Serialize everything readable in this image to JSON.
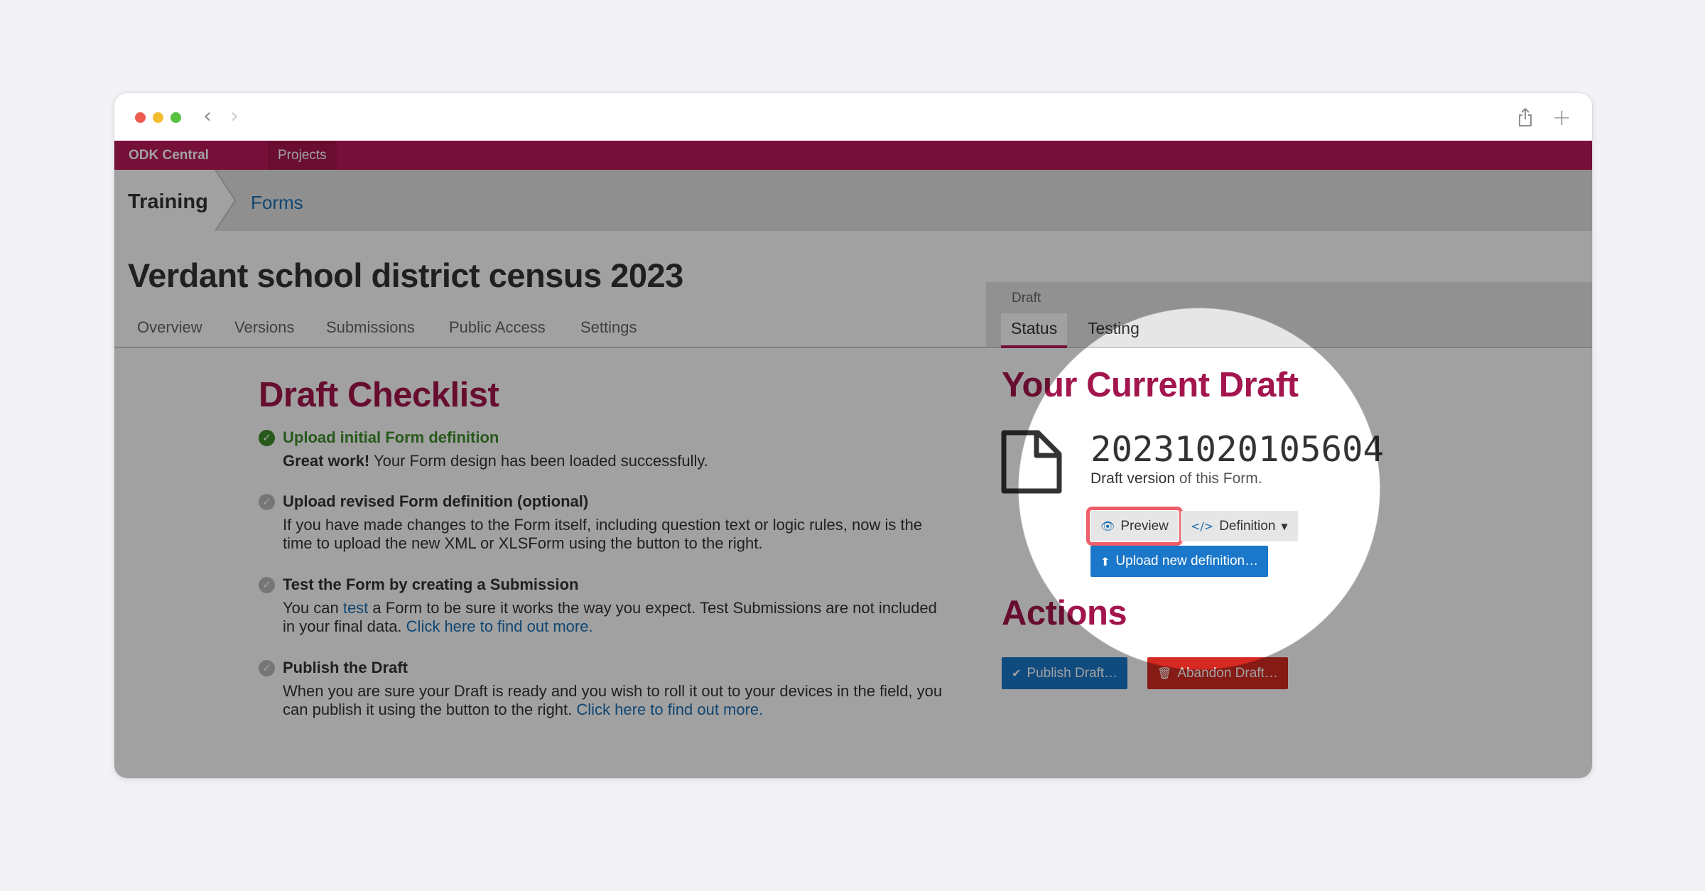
{
  "browser": {
    "back_icon": "chevron-left-icon",
    "forward_icon": "chevron-right-icon",
    "share_icon": "share-icon",
    "new_tab_icon": "plus-icon"
  },
  "navbar": {
    "brand": "ODK Central",
    "projects": "Projects"
  },
  "breadcrumb": {
    "project": "Training",
    "forms": "Forms"
  },
  "page_title": "Verdant school district census 2023",
  "tabs": [
    "Overview",
    "Versions",
    "Submissions",
    "Public Access",
    "Settings"
  ],
  "draft_panel": {
    "label": "Draft",
    "tab_status": "Status",
    "tab_testing": "Testing"
  },
  "checklist": {
    "heading": "Draft Checklist",
    "items": [
      {
        "title": "Upload initial Form definition",
        "body_strong": "Great work!",
        "body_rest": " Your Form design has been loaded successfully."
      },
      {
        "title": "Upload revised Form definition (optional)",
        "body_line1": "If you have made changes to the Form itself, including question text or logic rules, now is the",
        "body_line2": "time to upload the new XML or XLSForm using the button to the right."
      },
      {
        "title": "Test the Form by creating a Submission",
        "body_pre": "You can ",
        "body_link": "test",
        "body_post": " a Form to be sure it works the way you expect. Test Submissions are not included",
        "body_line2": "in your final data. ",
        "body_link2": "Click here to find out more."
      },
      {
        "title": "Publish the Draft",
        "body_line1": "When you are sure your Draft is ready and you wish to roll it out to your devices in the field, you",
        "body_line2": "can publish it using the button to the right. ",
        "body_link2": "Click here to find out more."
      }
    ]
  },
  "current_draft": {
    "heading": "Your Current Draft",
    "version": "20231020105604",
    "sub_strong": "Draft version",
    "sub_rest": " of this Form.",
    "preview": "Preview",
    "definition": "Definition",
    "upload": "Upload new definition…"
  },
  "actions": {
    "heading": "Actions",
    "publish": "Publish Draft…",
    "abandon": "Abandon Draft…"
  },
  "colors": {
    "brand": "#bc1a5b",
    "heading": "#a3154d",
    "primary_button": "#1a77c9",
    "danger_button": "#d52a22",
    "success": "#3f8d2c",
    "highlight": "#ee5f6a"
  }
}
